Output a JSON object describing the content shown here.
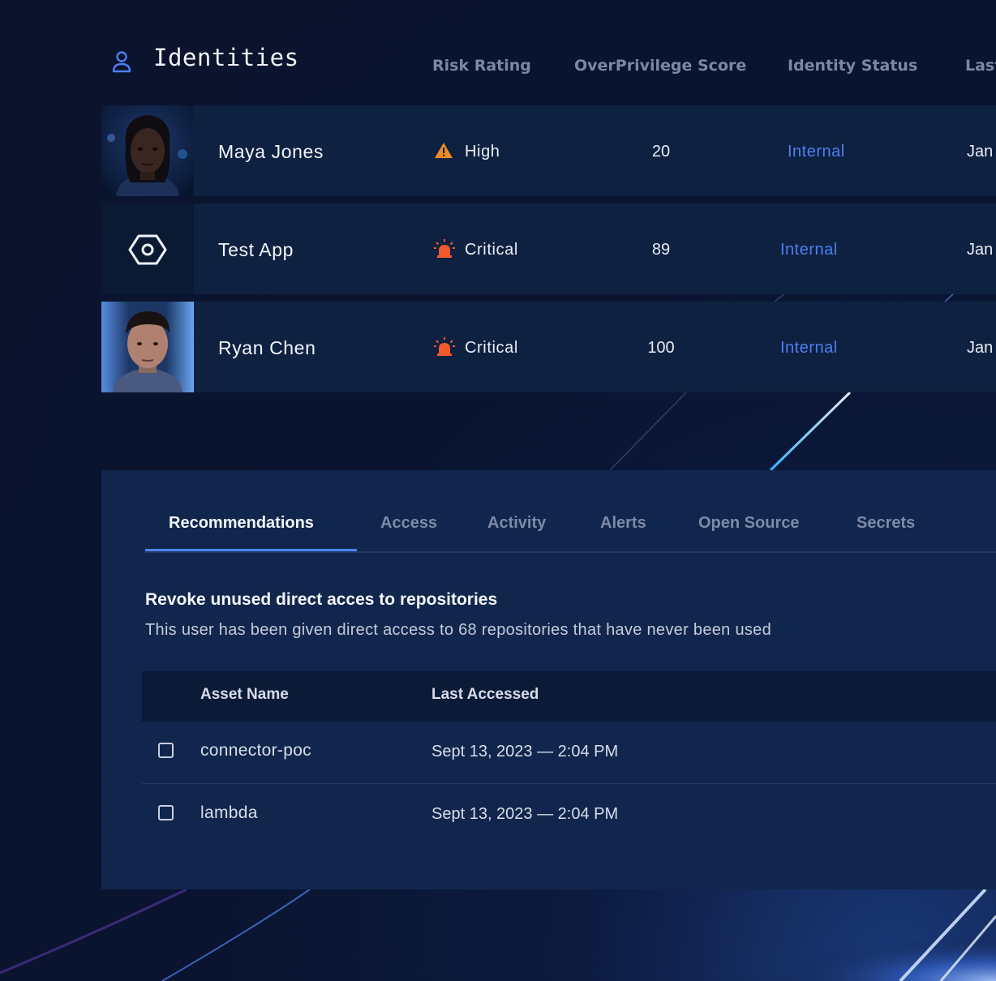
{
  "header": {
    "title": "Identities",
    "columns": [
      "Risk Rating",
      "OverPrivilege Score",
      "Identity Status",
      "Last"
    ]
  },
  "identities": [
    {
      "name": "Maya Jones",
      "risk": "High",
      "risk_icon": "warning-icon",
      "score": "20",
      "status": "Internal",
      "last": "Jan"
    },
    {
      "name": "Test App",
      "risk": "Critical",
      "risk_icon": "alarm-icon",
      "score": "89",
      "status": "Internal",
      "last": "Jan"
    },
    {
      "name": "Ryan Chen",
      "risk": "Critical",
      "risk_icon": "alarm-icon",
      "score": "100",
      "status": "Internal",
      "last": "Jan"
    }
  ],
  "tabs": [
    "Recommendations",
    "Access",
    "Activity",
    "Alerts",
    "Open Source",
    "Secrets"
  ],
  "active_tab": "Recommendations",
  "recommendation": {
    "title": "Revoke unused direct acces to repositories",
    "description": "This user has been given direct access to 68 repositories that have never been used"
  },
  "assets": {
    "columns": [
      "Asset Name",
      "Last Accessed"
    ],
    "rows": [
      {
        "name": "connector-poc",
        "last_accessed": "Sept 13, 2023 — 2:04 PM",
        "checked": false
      },
      {
        "name": "lambda",
        "last_accessed": "Sept 13, 2023 — 2:04 PM",
        "checked": false
      }
    ]
  },
  "colors": {
    "accent": "#4c7ff0",
    "high": "#f08a24",
    "critical": "#f0592e",
    "background": "#0b132c"
  }
}
